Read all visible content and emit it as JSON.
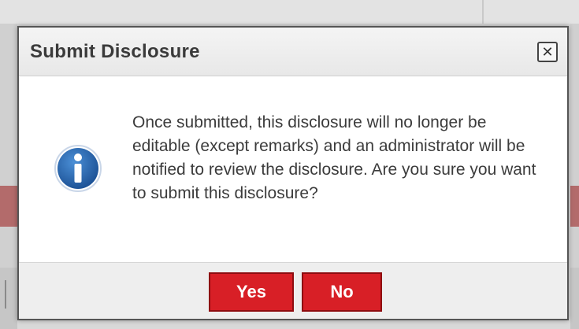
{
  "dialog": {
    "title": "Submit Disclosure",
    "close_icon": "close-icon",
    "info_icon": "info-icon",
    "message": "Once submitted, this disclosure will no longer be editable (except remarks) and an administrator will be notified to review the disclosure. Are you sure you want to submit this disclosure?",
    "buttons": {
      "yes_label": "Yes",
      "no_label": "No"
    }
  },
  "colors": {
    "button_red": "#d81f26",
    "info_blue": "#1f5fa8",
    "background_band": "#b36b6b"
  }
}
